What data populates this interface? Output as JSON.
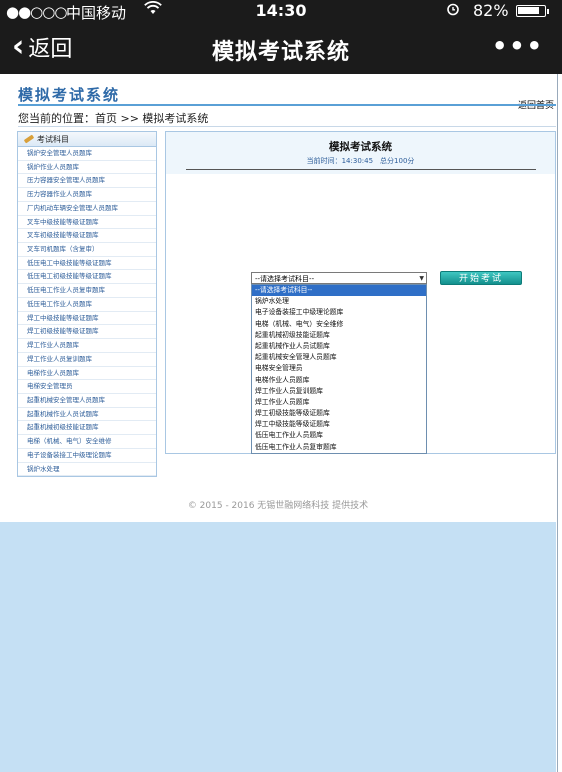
{
  "status_bar": {
    "signal": "●●○○○",
    "carrier": "中国移动",
    "wifi_icon": "wifi-icon",
    "time": "14:30",
    "alarm_icon": "alarm-icon",
    "battery_percent": "82%",
    "battery_level": 0.82
  },
  "nav": {
    "back_label": "返回",
    "back_icon": "‹",
    "title": "模拟考试系统",
    "more_icon": "•••"
  },
  "header": {
    "site_title": "模拟考试系统",
    "return_home": "返回首页"
  },
  "breadcrumb": "您当前的位置：首页 >> 模拟考试系统",
  "sidebar": {
    "heading": "考试科目",
    "items": [
      "锅炉安全管理人员题库",
      "锅炉作业人员题库",
      "压力容器安全管理人员题库",
      "压力容器作业人员题库",
      "厂内机动车辆安全管理人员题库",
      "叉车中级技能等级证题库",
      "叉车初级技能等级证题库",
      "叉车司机题库（含复审）",
      "低压电工中级技能等级证题库",
      "低压电工初级技能等级证题库",
      "低压电工作业人员复审题库",
      "低压电工作业人员题库",
      "焊工中级技能等级证题库",
      "焊工初级技能等级证题库",
      "焊工作业人员题库",
      "焊工作业人员复训题库",
      "电梯作业人员题库",
      "电梯安全管理员",
      "起重机械安全管理人员题库",
      "起重机械作业人员试题库",
      "起重机械初级技能证题库",
      "电梯（机械、电气）安全维修",
      "电子设备装接工中级理论题库",
      "锅炉水处理"
    ]
  },
  "exam": {
    "title": "模拟考试系统",
    "time_info": "当前时间：14:30:45　总分100分",
    "select_value": "--请选择考试科目--",
    "start_button": "开始考试",
    "options": [
      "--请选择考试科目--",
      "锅炉水处理",
      "电子设备装接工中级理论题库",
      "电梯（机械、电气）安全维修",
      "起重机械初级技能证题库",
      "起重机械作业人员试题库",
      "起重机械安全管理人员题库",
      "电梯安全管理员",
      "电梯作业人员题库",
      "焊工作业人员复训题库",
      "焊工作业人员题库",
      "焊工初级技能等级证题库",
      "焊工中级技能等级证题库",
      "低压电工作业人员题库",
      "低压电工作业人员复审题库",
      "低压电工初级技能等级证题库"
    ]
  },
  "footer": "© 2015 - 2016 无锡世融网络科技 提供技术",
  "colors": {
    "bar_bg": "#1b1b1b",
    "title_blue": "#2f6aa8",
    "link_blue": "#2d5d99",
    "button_teal": "#13908d",
    "page_bottom": "#c5e0f4"
  }
}
